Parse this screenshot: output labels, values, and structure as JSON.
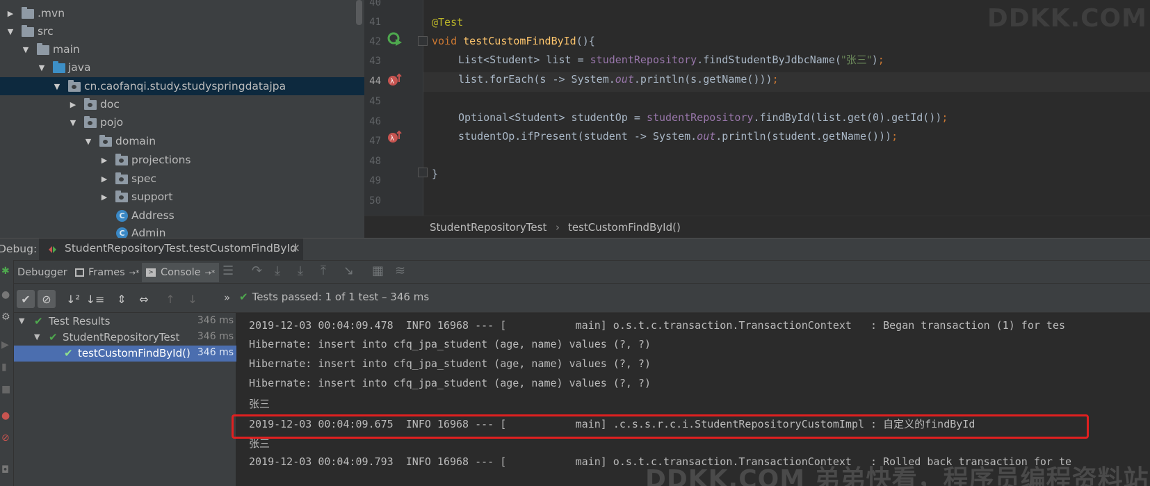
{
  "project_tree": {
    "items": [
      {
        "label": ".mvn",
        "kind": "folder"
      },
      {
        "label": "src",
        "kind": "folder"
      },
      {
        "label": "main",
        "kind": "folder"
      },
      {
        "label": "java",
        "kind": "folder-blue"
      },
      {
        "label": "cn.caofanqi.study.studyspringdatajpa",
        "kind": "package"
      },
      {
        "label": "doc",
        "kind": "package"
      },
      {
        "label": "pojo",
        "kind": "package"
      },
      {
        "label": "domain",
        "kind": "package"
      },
      {
        "label": "projections",
        "kind": "package"
      },
      {
        "label": "spec",
        "kind": "package"
      },
      {
        "label": "support",
        "kind": "package"
      },
      {
        "label": "Address",
        "kind": "class"
      },
      {
        "label": "Admin",
        "kind": "class"
      }
    ],
    "class_icon_letter": "C"
  },
  "editor": {
    "line_numbers": [
      "40",
      "41",
      "42",
      "43",
      "44",
      "45",
      "46",
      "47",
      "48",
      "49",
      "50"
    ],
    "code": {
      "l41_annotation": "@Test",
      "l42_void": "void",
      "l42_method": "testCustomFindById",
      "l42_rest": "(){",
      "l43_type": "List<Student> list = ",
      "l43_field": "studentRepository",
      "l43_call": ".findStudentByJdbcName(",
      "l43_string": "\"张三\"",
      "l43_close": ")",
      "l44_a": "list.forEach(s -> System.",
      "l44_static": "out",
      "l44_b": ".println(s.getName()))",
      "l46_type": "Optional<Student> studentOp = ",
      "l46_field": "studentRepository",
      "l46_call": ".findById(list.get(0).getId())",
      "l47_a": "studentOp.ifPresent(student -> System.",
      "l47_static": "out",
      "l47_b": ".println(student.getName()))",
      "l49_brace": "}",
      "semicolon": ";"
    },
    "watermark": "DDKK.COM",
    "breadcrumb": [
      "StudentRepositoryTest",
      "testCustomFindById()"
    ],
    "breadcrumb_sep": "›"
  },
  "debug": {
    "label": "Debug:",
    "session_tab": "StudentRepositoryTest.testCustomFindById",
    "close_glyph": "×",
    "tabs": {
      "debugger": "Debugger",
      "frames": "Frames",
      "console": "Console",
      "pin_glyph": "→*"
    },
    "tests_status": "Tests passed: 1 of 1 test – 346 ms",
    "more_glyph": "»"
  },
  "test_results": [
    {
      "label": "Test Results",
      "time": "346 ms"
    },
    {
      "label": "StudentRepositoryTest",
      "time": "346 ms"
    },
    {
      "label": "testCustomFindById()",
      "time": "346 ms"
    }
  ],
  "console": {
    "lines": [
      "2019-12-03 00:04:09.478  INFO 16968 --- [           main] o.s.t.c.transaction.TransactionContext   : Began transaction (1) for tes",
      "Hibernate: insert into cfq_jpa_student (age, name) values (?, ?)",
      "Hibernate: insert into cfq_jpa_student (age, name) values (?, ?)",
      "Hibernate: insert into cfq_jpa_student (age, name) values (?, ?)",
      "张三",
      "2019-12-03 00:04:09.675  INFO 16968 --- [           main] .c.s.s.r.c.i.StudentRepositoryCustomImpl : 自定义的findById",
      "张三",
      "2019-12-03 00:04:09.793  INFO 16968 --- [           main] o.s.t.c.transaction.TransactionContext   : Rolled back transaction for te"
    ],
    "watermark": "DDKK.COM 弟弟快看，程序员编程资料站"
  },
  "colors": {
    "accent_selection": "#4b6eaf",
    "pass_green": "#4ea84e",
    "highlight_red": "#e02020"
  }
}
